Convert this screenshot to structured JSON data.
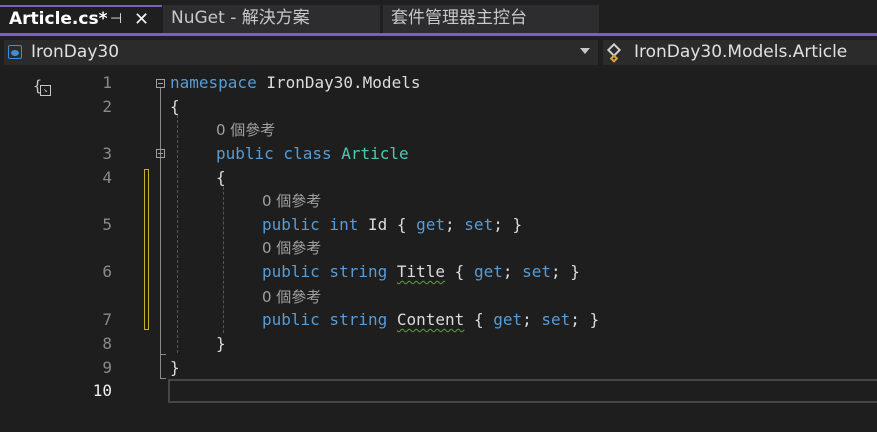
{
  "tabs": [
    {
      "name": "Article.cs*",
      "pin": "⊣",
      "close": "✕"
    },
    {
      "name": "NuGet - 解決方案"
    },
    {
      "name": "套件管理器主控台"
    }
  ],
  "nav": {
    "project": "IronDay30",
    "member": "IronDay30.Models.Article"
  },
  "editor": {
    "line_numbers": [
      "1",
      "2",
      "3",
      "4",
      "5",
      "6",
      "7",
      "8",
      "9",
      "10"
    ],
    "codelens": "0 個參考",
    "code": {
      "l1_kw": "namespace",
      "l1_rest": " IronDay30.Models",
      "l2": "{",
      "l3_kw": "public class",
      "l3_cls": "Article",
      "l4": "{",
      "l5_kw1": "public int",
      "l5_id": " Id { ",
      "l5_get": "get",
      "l5_sep": "; ",
      "l5_set": "set",
      "l5_end": "; }",
      "l6_kw1": "public string",
      "l6_name": "Title",
      "l6_open": " { ",
      "l6_get": "get",
      "l6_sep": "; ",
      "l6_set": "set",
      "l6_end": "; }",
      "l7_kw1": "public string",
      "l7_name": "Content",
      "l7_open": " { ",
      "l7_get": "get",
      "l7_sep": "; ",
      "l7_set": "set",
      "l7_end": "; }",
      "l8": "}",
      "l9": "}"
    }
  },
  "colors": {
    "keyword": "#569cd6",
    "class": "#4ec9b0",
    "accent": "#7b5fc9",
    "change_marker": "#c2b428"
  }
}
